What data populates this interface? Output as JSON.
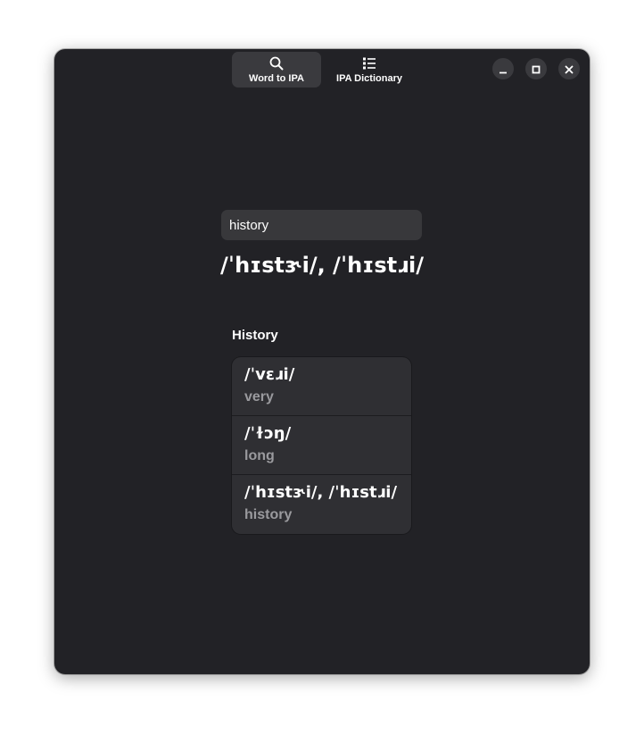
{
  "header": {
    "tabs": [
      {
        "label": "Word to IPA",
        "icon": "search-icon",
        "active": true
      },
      {
        "label": "IPA Dictionary",
        "icon": "list-icon",
        "active": false
      }
    ],
    "controls": [
      "minimize-icon",
      "maximize-icon",
      "close-icon"
    ]
  },
  "search": {
    "value": "history",
    "placeholder": ""
  },
  "result": {
    "ipa": "/ˈhɪstɝi/, /ˈhɪstɹi/"
  },
  "history": {
    "heading": "History",
    "items": [
      {
        "ipa": "/ˈvɛɹi/",
        "word": "very"
      },
      {
        "ipa": "/ˈɫɔŋ/",
        "word": "long"
      },
      {
        "ipa": "/ˈhɪstɝi/, /ˈhɪstɹi/",
        "word": "history"
      }
    ]
  },
  "colors": {
    "window_bg": "#222226",
    "surface": "#2f2f33",
    "entry_bg": "#38383b",
    "secondary_text": "#9a9a9e"
  }
}
